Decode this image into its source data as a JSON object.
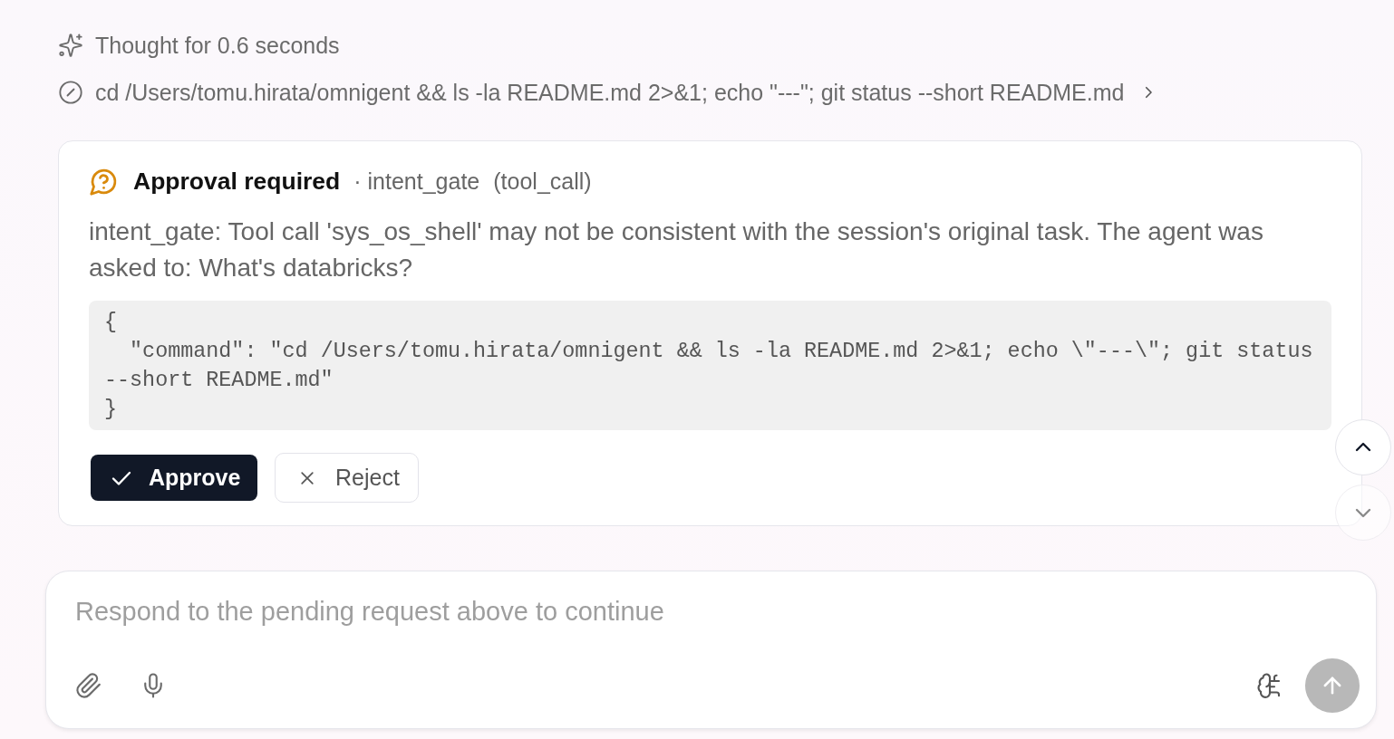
{
  "thinking": {
    "label": "Thought for 0.6 seconds"
  },
  "tool_call": {
    "command": "cd /Users/tomu.hirata/omnigent && ls -la README.md 2>&1; echo \"---\"; git status --short README.md",
    "expanded": false
  },
  "approval": {
    "title": "Approval required",
    "source": "· intent_gate",
    "call_type": "(tool_call)",
    "message": "intent_gate: Tool call 'sys_os_shell' may not be consistent with the session's original task. The agent was asked to: What's databricks?",
    "payload": "{\n  \"command\": \"cd /Users/tomu.hirata/omnigent && ls -la README.md 2>&1; echo \\\"---\\\"; git status --short README.md\"\n}",
    "actions": [
      {
        "kind": "approve",
        "label": "Approve"
      },
      {
        "kind": "reject",
        "label": "Reject"
      }
    ]
  },
  "scroll_buttons": [
    {
      "kind": "up",
      "disabled": false
    },
    {
      "kind": "down",
      "disabled": true
    }
  ],
  "composer": {
    "placeholder": "Respond to the pending request above to continue",
    "send": {
      "disabled": true
    }
  }
}
